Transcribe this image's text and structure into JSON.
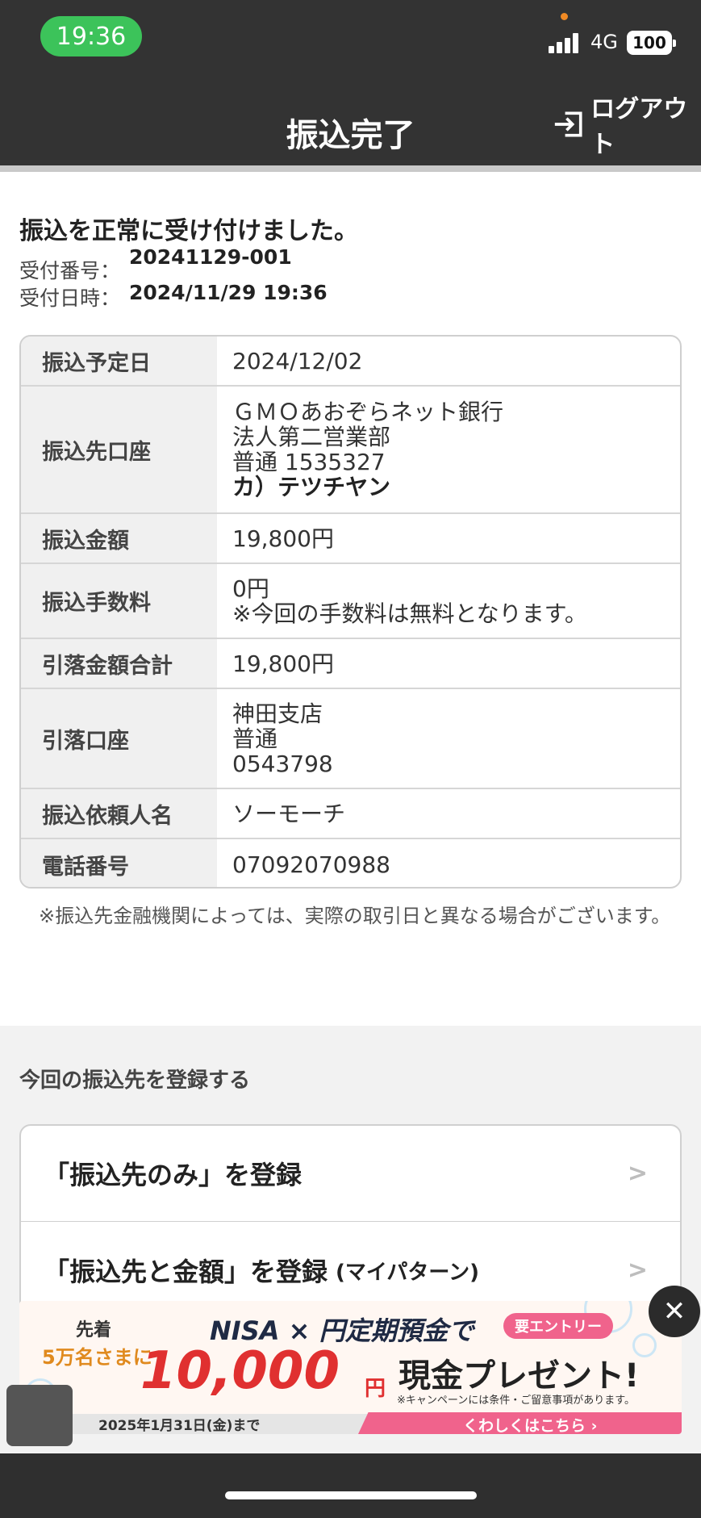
{
  "status_bar": {
    "time": "19:36",
    "network": "4G",
    "battery": "100"
  },
  "header": {
    "title": "振込完了",
    "logout_label": "ログアウト"
  },
  "result": {
    "message": "振込を正常に受け付けました。",
    "receipt_no_label": "受付番号：",
    "receipt_no": "20241129-001",
    "receipt_dt_label": "受付日時：",
    "receipt_dt": "2024/11/29 19:36"
  },
  "details": [
    {
      "label": "振込予定日",
      "lines": [
        "2024/12/02"
      ]
    },
    {
      "label": "振込先口座",
      "lines": [
        "ＧＭＯあおぞらネット銀行",
        "法人第二営業部",
        "普通 1535327"
      ],
      "bold_line": "カ）テツチヤン"
    },
    {
      "label": "振込金額",
      "lines": [
        "19,800円"
      ]
    },
    {
      "label": "振込手数料",
      "lines": [
        "0円",
        "※今回の手数料は無料となります。"
      ]
    },
    {
      "label": "引落金額合計",
      "lines": [
        "19,800円"
      ]
    },
    {
      "label": "引落口座",
      "lines": [
        "神田支店",
        "普通",
        "0543798"
      ]
    },
    {
      "label": "振込依頼人名",
      "lines": [
        "ソーモーチ"
      ]
    },
    {
      "label": "電話番号",
      "lines": [
        "07092070988"
      ]
    }
  ],
  "note": "※振込先金融機関によっては、実際の取引日と異なる場合がございます。",
  "register": {
    "heading": "今回の振込先を登録する",
    "option1": "「振込先のみ」を登録",
    "option2": "「振込先と金額」を登録",
    "option2_sub": "(マイパターン)"
  },
  "banner": {
    "first": "先着",
    "fifty": "5万名さまに",
    "nisa": "NISA × 円定期預金で",
    "entry": "要エントリー",
    "amount": "10,000",
    "yen": "円",
    "cash": "現金プレゼント!",
    "conditions": "※キャンペーンには条件・ご留意事項があります。",
    "until": "2025年1月31日(金)まで",
    "more": "くわしくはこちら ›"
  },
  "colors": {
    "header_bg": "#333333",
    "time_pill": "#3cc35a",
    "accent_pink": "#f0638c",
    "amount_red": "#e03030"
  }
}
